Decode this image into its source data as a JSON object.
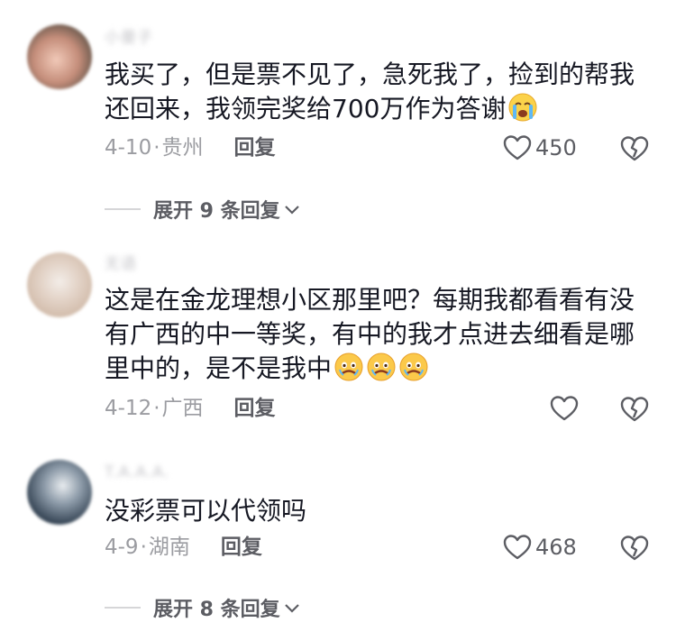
{
  "comments": [
    {
      "username": "小曼子",
      "text": "我买了，但是票不见了，急死我了，捡到的帮我还回来，我领完奖给700万作为答谢",
      "date": "4-10",
      "location": "贵州",
      "reply_label": "回复",
      "likes": "450",
      "emoji_icon": "crying-face-icon"
    },
    {
      "username": "无语",
      "text": "这是在金龙理想小区那里吧？每期我都看看有没有广西的中一等奖，有中的我才点进去细看是哪里中的，是不是我中",
      "date": "4-12",
      "location": "广西",
      "reply_label": "回复",
      "likes": "",
      "emoji_icon": "teary-face-icon"
    },
    {
      "username": "T.A.A.A.",
      "text": "没彩票可以代领吗",
      "date": "4-9",
      "location": "湖南",
      "reply_label": "回复",
      "likes": "468"
    }
  ],
  "expand_1": "展开 9 条回复",
  "expand_2": "展开 8 条回复",
  "meta_separator": "·"
}
